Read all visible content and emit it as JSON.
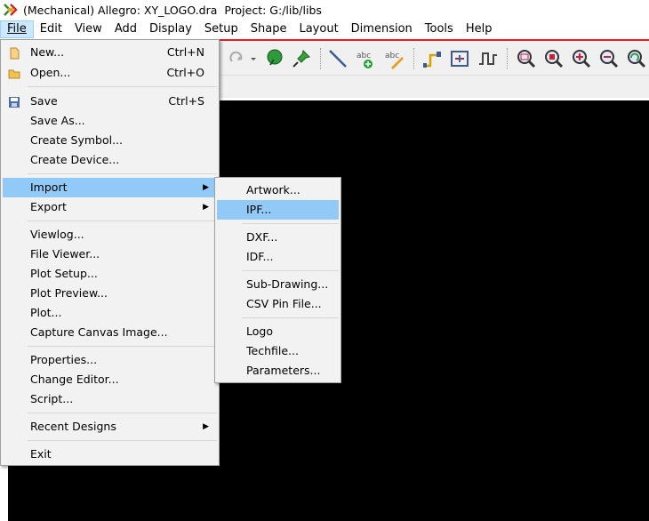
{
  "window": {
    "title": "(Mechanical) Allegro: XY_LOGO.dra  Project: G:/lib/libs"
  },
  "menubar": [
    {
      "label": "File"
    },
    {
      "label": "Edit"
    },
    {
      "label": "View"
    },
    {
      "label": "Add"
    },
    {
      "label": "Display"
    },
    {
      "label": "Setup"
    },
    {
      "label": "Shape"
    },
    {
      "label": "Layout"
    },
    {
      "label": "Dimension"
    },
    {
      "label": "Tools"
    },
    {
      "label": "Help"
    }
  ],
  "file_menu": {
    "items": [
      {
        "label": "New...",
        "shortcut": "Ctrl+N",
        "icon": "new-file-icon"
      },
      {
        "label": "Open...",
        "shortcut": "Ctrl+O",
        "icon": "open-folder-icon"
      },
      {
        "label": "Save",
        "shortcut": "Ctrl+S",
        "icon": "save-disk-icon"
      },
      {
        "label": "Save As..."
      },
      {
        "label": "Create Symbol..."
      },
      {
        "label": "Create Device..."
      },
      {
        "label": "Import",
        "submenu": true
      },
      {
        "label": "Export",
        "submenu": true
      },
      {
        "label": "Viewlog..."
      },
      {
        "label": "File Viewer..."
      },
      {
        "label": "Plot Setup..."
      },
      {
        "label": "Plot Preview..."
      },
      {
        "label": "Plot..."
      },
      {
        "label": "Capture Canvas Image..."
      },
      {
        "label": "Properties..."
      },
      {
        "label": "Change Editor..."
      },
      {
        "label": "Script..."
      },
      {
        "label": "Recent Designs",
        "submenu": true
      },
      {
        "label": "Exit"
      }
    ]
  },
  "import_submenu": {
    "items": [
      {
        "label": "Artwork..."
      },
      {
        "label": "IPF..."
      },
      {
        "label": "DXF..."
      },
      {
        "label": "IDF..."
      },
      {
        "label": "Sub-Drawing..."
      },
      {
        "label": "CSV Pin File..."
      },
      {
        "label": "Logo"
      },
      {
        "label": "Techfile..."
      },
      {
        "label": "Parameters..."
      }
    ]
  },
  "toolbar": {
    "icons": [
      "redo-icon",
      "dropdown-arrow-icon",
      "pick-icon",
      "pin-icon",
      "add-line-icon",
      "add-text-icon",
      "edit-text-icon",
      "route-connect-icon",
      "slide-icon",
      "delay-tune-icon",
      "zoom-in-icon",
      "zoom-fit-icon",
      "zoom-in-plus-icon",
      "zoom-out-icon",
      "zoom-previous-icon"
    ]
  },
  "colors": {
    "highlight": "#91c9f7",
    "menu_active": "#cce8ff",
    "accent_line": "#e02020",
    "canvas": "#000000"
  }
}
